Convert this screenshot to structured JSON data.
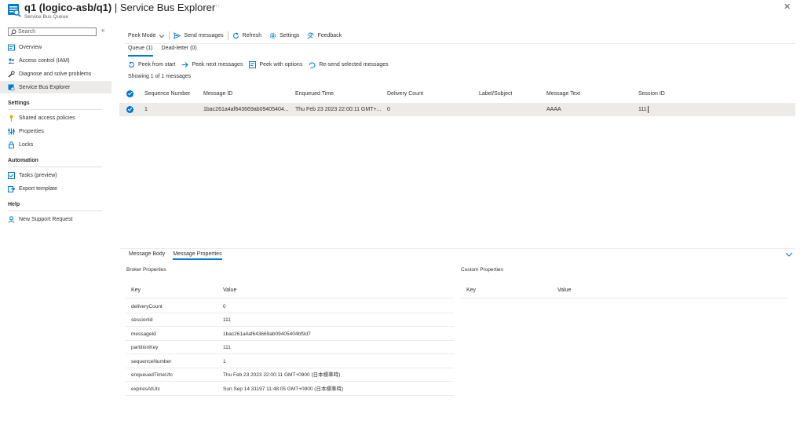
{
  "header": {
    "title_bold": "q1 (logico-asb/q1)",
    "title_sep": " | ",
    "title_rest": "Service Bus Explorer",
    "subtitle": "Service Bus Queue",
    "more": "···",
    "close": "✕"
  },
  "sidebar": {
    "search_placeholder": "Search",
    "collapse": "«",
    "items": [
      {
        "label": "Overview",
        "icon": "overview-icon"
      },
      {
        "label": "Access control (IAM)",
        "icon": "people-icon"
      },
      {
        "label": "Diagnose and solve problems",
        "icon": "wrench-icon"
      },
      {
        "label": "Service Bus Explorer",
        "icon": "explorer-icon"
      }
    ],
    "sections": [
      {
        "title": "Settings",
        "items": [
          {
            "label": "Shared access policies",
            "icon": "key-icon"
          },
          {
            "label": "Properties",
            "icon": "sliders-icon"
          },
          {
            "label": "Locks",
            "icon": "lock-icon"
          }
        ]
      },
      {
        "title": "Automation",
        "items": [
          {
            "label": "Tasks (preview)",
            "icon": "tasks-icon"
          },
          {
            "label": "Export template",
            "icon": "export-icon"
          }
        ]
      },
      {
        "title": "Help",
        "items": [
          {
            "label": "New Support Request",
            "icon": "support-icon"
          }
        ]
      }
    ]
  },
  "toolbar": {
    "peek_mode": "Peek Mode",
    "send": "Send messages",
    "refresh": "Refresh",
    "settings": "Settings",
    "feedback": "Feedback"
  },
  "tabs": [
    "Queue (1)",
    "Dead-letter (0)"
  ],
  "actions": {
    "peek_start": "Peek from start",
    "peek_next": "Peek next messages",
    "peek_options": "Peek with options",
    "resend": "Re-send selected messages"
  },
  "showing": "Showing 1 of 1 messages",
  "grid": {
    "columns": [
      "Sequence Number",
      "Message ID",
      "Enqueued Time",
      "Delivery Count",
      "Label/Subject",
      "Message Text",
      "Session ID"
    ],
    "rows": [
      [
        "1",
        "1bac261a4af643669ab09405404...",
        "Thu Feb 23 2023 22:00:11 GMT+...",
        "0",
        "",
        "AAAA",
        "111"
      ]
    ]
  },
  "detail": {
    "tabs": [
      "Message Body",
      "Message Properties"
    ],
    "broker_title": "Broker Properties",
    "custom_title": "Custom Properties",
    "key_header": "Key",
    "value_header": "Value",
    "broker": [
      {
        "k": "deliveryCount",
        "v": "0"
      },
      {
        "k": "sessionId",
        "v": "111"
      },
      {
        "k": "messageId",
        "v": "1bac261a4af643669ab09405404bf9d7"
      },
      {
        "k": "partitionKey",
        "v": "111"
      },
      {
        "k": "sequenceNumber",
        "v": "1"
      },
      {
        "k": "enqueuedTimeUtc",
        "v": "Thu Feb 23 2023 22:00:11 GMT+0900 (日本標準時)"
      },
      {
        "k": "expiresAtUtc",
        "v": "Sun Sep 14 31197 11:48:05 GMT+0900 (日本標準時)"
      }
    ]
  },
  "colors": {
    "accent": "#0078d4",
    "selected_row": "#edebe9"
  }
}
